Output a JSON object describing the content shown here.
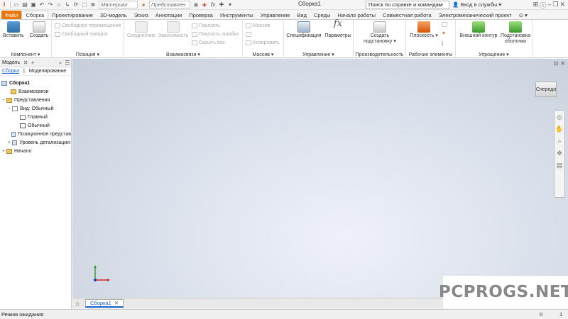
{
  "title_bar": {
    "title": "Сборка1",
    "material_combo": "Материал",
    "appearance_combo": "Представлен",
    "search_placeholder": "Поиск по справке и командам",
    "signin": "Вход в службы"
  },
  "tabs": [
    {
      "label": "Файл"
    },
    {
      "label": "Сборка"
    },
    {
      "label": "Проектирование"
    },
    {
      "label": "3D-модель"
    },
    {
      "label": "Эскиз"
    },
    {
      "label": "Аннотации"
    },
    {
      "label": "Проверка"
    },
    {
      "label": "Инструменты"
    },
    {
      "label": "Управление"
    },
    {
      "label": "Вид"
    },
    {
      "label": "Среды"
    },
    {
      "label": "Начало работы"
    },
    {
      "label": "Совместная работа"
    },
    {
      "label": "Электромеханический проект"
    }
  ],
  "ribbon": {
    "component": {
      "title": "Компонент",
      "insert": "Вставить",
      "create": "Создать"
    },
    "position": {
      "title": "Позиция",
      "free_move": "Свободное перемещение",
      "free_rotate": "Свободный поворот"
    },
    "relationships": {
      "title": "Взаимосвязи",
      "joint": "Соединение",
      "constraint": "Зависимость",
      "show": "Показать",
      "show_errors": "Показать ошибки",
      "hide_all": "Скрыть все"
    },
    "pattern": {
      "title": "Массив",
      "pattern": "Массив",
      "copy": "Копировать"
    },
    "manage": {
      "title": "Управление",
      "bom": "Спецификация",
      "parameters": "Параметры"
    },
    "productivity": {
      "title": "Производительность",
      "create_substitute": "Создать подстановку"
    },
    "work_features": {
      "title": "Рабочие элементы",
      "plane": "Плоскость"
    },
    "simplification": {
      "title": "Упрощение",
      "shrinkwrap": "Внешний контур",
      "shrinkwrap_sub": "Подстановка оболочки"
    }
  },
  "browser": {
    "tab_label": "Модель",
    "sub_tabs": [
      "Сборка",
      "Моделирование"
    ],
    "tree": [
      {
        "label": "Сборка1",
        "level": 0
      },
      {
        "label": "Взаимосвязи",
        "level": 1
      },
      {
        "label": "Представления",
        "level": 1
      },
      {
        "label": "Вид: Обычный",
        "level": 2
      },
      {
        "label": "Главный",
        "level": 3
      },
      {
        "label": "Обычный",
        "level": 3
      },
      {
        "label": "Позиционное представ",
        "level": 2
      },
      {
        "label": "Уровень детализации: ",
        "level": 2
      },
      {
        "label": "Начало",
        "level": 1
      }
    ]
  },
  "viewcube": {
    "label": "Спереди"
  },
  "doc_tabs": [
    {
      "label": "Сборка1"
    }
  ],
  "status": {
    "text": "Режим ожидания",
    "count1": "0",
    "count2": "1"
  },
  "watermark": "PCPROGS.NET",
  "colors": {
    "file_tab": "#e8780d",
    "accent": "#1b66c9"
  }
}
